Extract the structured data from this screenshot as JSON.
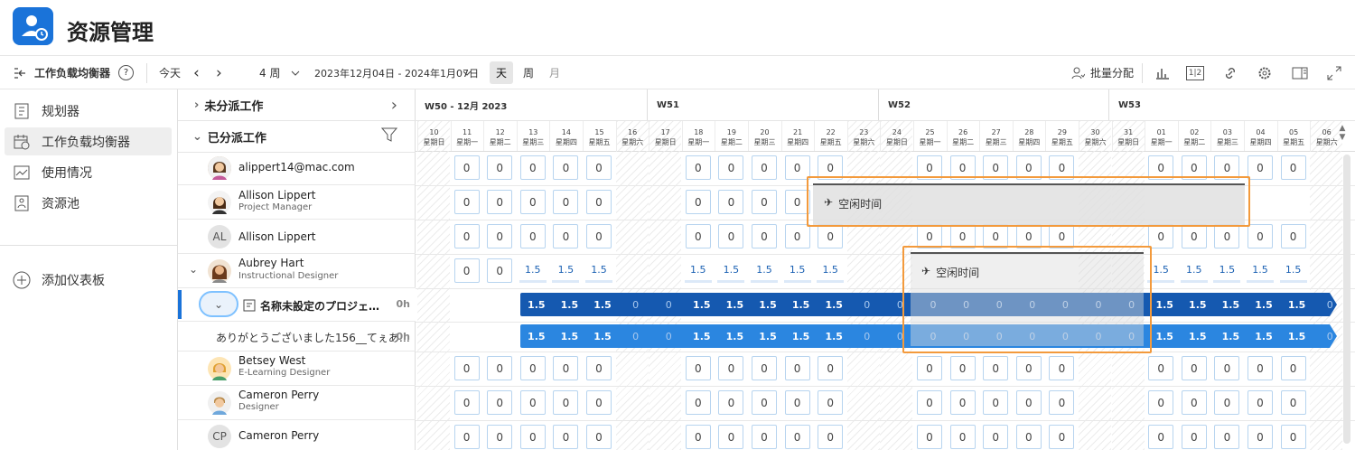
{
  "app": {
    "title": "资源管理"
  },
  "toolbar": {
    "workload": "工作负载均衡器",
    "help": "?",
    "today": "今天",
    "prev": "‹",
    "next": "›",
    "weeks": "4 周",
    "range": "2023年12月04日 - 2024年1月07日",
    "view_day": "天",
    "view_week": "周",
    "view_month": "月",
    "bulk_assign": "批量分配",
    "ratio": "1|2"
  },
  "sidebar": {
    "items": [
      {
        "label": "规划器"
      },
      {
        "label": "工作负载均衡器"
      },
      {
        "label": "使用情况"
      },
      {
        "label": "资源池"
      }
    ],
    "add_dashboard": "添加仪表板"
  },
  "sections": {
    "unassigned": "未分派工作",
    "assigned": "已分派工作"
  },
  "people": [
    {
      "name": "alippert14@mac.com",
      "role": ""
    },
    {
      "name": "Allison Lippert",
      "role": "Project Manager"
    },
    {
      "name": "Allison Lippert",
      "role": "",
      "initials": "AL"
    },
    {
      "name": "Aubrey Hart",
      "role": "Instructional Designer"
    },
    {
      "name": "Betsey West",
      "role": "E-Learning Designer"
    },
    {
      "name": "Cameron Perry",
      "role": "Designer"
    },
    {
      "name": "Cameron Perry",
      "role": "",
      "initials": "CP"
    }
  ],
  "project_row": {
    "name": "名称未設定のプロジェ…",
    "hours": "0h"
  },
  "task_row": {
    "name": "ありがとうございました156__てぇあ…",
    "hours": "0h"
  },
  "weeks": [
    {
      "label": "W50 - 12月 2023"
    },
    {
      "label": "W51"
    },
    {
      "label": "W52"
    },
    {
      "label": "W53"
    }
  ],
  "days": [
    {
      "d": "10",
      "w": "星期日"
    },
    {
      "d": "11",
      "w": "星期一"
    },
    {
      "d": "12",
      "w": "星期二"
    },
    {
      "d": "13",
      "w": "星期三"
    },
    {
      "d": "14",
      "w": "星期四"
    },
    {
      "d": "15",
      "w": "星期五"
    },
    {
      "d": "16",
      "w": "星期六"
    },
    {
      "d": "17",
      "w": "星期日"
    },
    {
      "d": "18",
      "w": "星期一"
    },
    {
      "d": "19",
      "w": "星期二"
    },
    {
      "d": "20",
      "w": "星期三"
    },
    {
      "d": "21",
      "w": "星期四"
    },
    {
      "d": "22",
      "w": "星期五"
    },
    {
      "d": "23",
      "w": "星期六"
    },
    {
      "d": "24",
      "w": "星期日"
    },
    {
      "d": "25",
      "w": "星期一"
    },
    {
      "d": "26",
      "w": "星期二"
    },
    {
      "d": "27",
      "w": "星期三"
    },
    {
      "d": "28",
      "w": "星期四"
    },
    {
      "d": "29",
      "w": "星期五"
    },
    {
      "d": "30",
      "w": "星期六"
    },
    {
      "d": "31",
      "w": "星期日"
    },
    {
      "d": "01",
      "w": "星期一"
    },
    {
      "d": "02",
      "w": "星期二"
    },
    {
      "d": "03",
      "w": "星期三"
    },
    {
      "d": "04",
      "w": "星期四"
    },
    {
      "d": "05",
      "w": "星期五"
    },
    {
      "d": "06",
      "w": "星期六"
    }
  ],
  "time_off": "空闲时间",
  "values": {
    "zero": "0",
    "aubrey_row": [
      "",
      "0",
      "0",
      "1.5",
      "1.5",
      "1.5",
      "",
      "",
      "1.5",
      "1.5",
      "1.5",
      "1.5",
      "1.5",
      "",
      "",
      "",
      "",
      "",
      "",
      "",
      "",
      "",
      "1.5",
      "1.5",
      "1.5",
      "1.5",
      "1.5",
      ""
    ],
    "bar_row": [
      "",
      "",
      "",
      "1.5",
      "1.5",
      "1.5",
      "0",
      "0",
      "1.5",
      "1.5",
      "1.5",
      "1.5",
      "1.5",
      "0",
      "0",
      "0",
      "0",
      "0",
      "0",
      "0",
      "0",
      "0",
      "1.5",
      "1.5",
      "1.5",
      "1.5",
      "1.5",
      "0"
    ]
  },
  "colors": {
    "accent": "#1a73d9",
    "bar_dark": "#1559b0",
    "bar_light": "#2b86e0",
    "highlight": "#f39a3c"
  }
}
